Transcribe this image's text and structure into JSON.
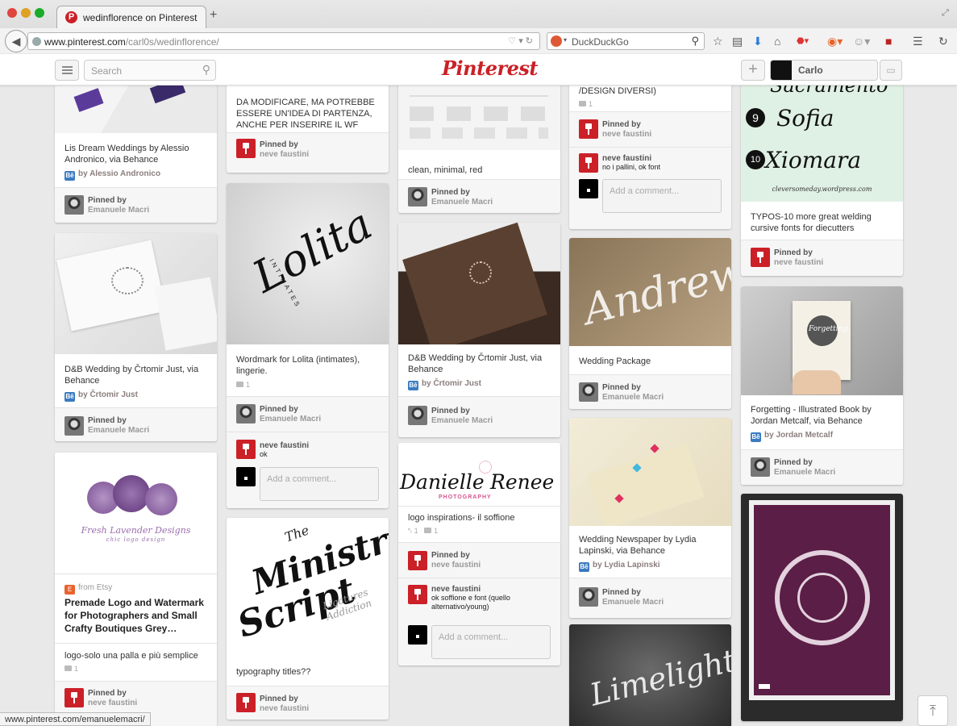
{
  "browser": {
    "tab_title": "wedinflorence on Pinterest",
    "url_host": "www.pinterest.com",
    "url_path": "/carl0s/wedinflorence/",
    "search_engine": "DuckDuckGo",
    "status_url": "www.pinterest.com/emanuelemacri/"
  },
  "header": {
    "search_placeholder": "Search",
    "logo": "Pinterest",
    "user_name": "Carlo"
  },
  "colors": {
    "pinterest_red": "#cb2027",
    "behance_blue": "#3b7bc0",
    "etsy_orange": "#e9622e"
  },
  "pins": {
    "p1": {
      "desc": "Lis Dream Weddings by Alessio Andronico, via Behance",
      "source": "by Alessio Andronico",
      "pinned_label": "Pinned by",
      "pinner": "Emanuele Macri"
    },
    "p2": {
      "desc": "D&B Wedding by Črtomir Just, via Behance",
      "source": "by Črtomir Just",
      "pinned_label": "Pinned by",
      "pinner": "Emanuele Macri"
    },
    "p3": {
      "source": "from Etsy",
      "title": "Premade Logo and Watermark for Photographers and Small Crafty Boutiques Grey…",
      "desc": "logo-solo una palla e più semplice",
      "comments": "1",
      "pinned_label": "Pinned by",
      "pinner": "neve faustini",
      "logo_script": "Fresh Lavender Designs",
      "logo_sub": "chic logo design"
    },
    "p4": {
      "desc": "DA MODIFICARE, MA POTREBBE ESSERE UN'IDEA DI PARTENZA, ANCHE PER INSERIRE IL WF",
      "pinned_label": "Pinned by",
      "pinner": "neve faustini"
    },
    "p5": {
      "desc": "Wordmark for Lolita (intimates), lingerie.",
      "comments": "1",
      "pinned_label": "Pinned by",
      "pinner": "Emanuele Macri",
      "commenter": "neve faustini",
      "comment": "ok",
      "add_comment": "Add a comment...",
      "art": "Lolita",
      "art_sub": "INTIMATES"
    },
    "p6": {
      "desc": "typography titles??",
      "pinned_label": "Pinned by",
      "pinner": "neve faustini",
      "art1": "The",
      "art2": "Ministry",
      "art3": "Script",
      "art4": "Ligatures Addiction"
    },
    "p7": {
      "desc": "clean, minimal, red",
      "pinned_label": "Pinned by",
      "pinner": "Emanuele Macri"
    },
    "p8": {
      "desc": "D&B Wedding by Črtomir Just, via Behance",
      "source": "by Črtomir Just",
      "pinned_label": "Pinned by",
      "pinner": "Emanuele Macri"
    },
    "p9": {
      "desc": "logo inspirations- il soffione",
      "likes": "1",
      "comments": "1",
      "pinned_label": "Pinned by",
      "pinner": "neve faustini",
      "commenter": "neve faustini",
      "comment": "ok soffione e font (quello alternativo/young)",
      "add_comment": "Add a comment...",
      "art1": "Danielle",
      "art2": "Renee",
      "art3": "PHOTOGRAPHY"
    },
    "p10": {
      "desc": "/DESIGN DIVERSI)",
      "comments": "1",
      "pinned_label": "Pinned by",
      "pinner": "neve faustini",
      "commenter": "neve faustini",
      "comment": "no i pallini, ok font",
      "add_comment": "Add a comment..."
    },
    "p11": {
      "desc": "Wedding Package",
      "pinned_label": "Pinned by",
      "pinner": "Emanuele Macri",
      "art": "Andrew"
    },
    "p12": {
      "desc": "Wedding Newspaper by Lydia Lapinski, via Behance",
      "source": "by Lydia Lapinski",
      "pinned_label": "Pinned by",
      "pinner": "Emanuele Macri"
    },
    "p13": {
      "art": "Limelight"
    },
    "p14": {
      "desc": "TYPOS-10 more great welding cursive fonts for diecutters",
      "pinned_label": "Pinned by",
      "pinner": "neve faustini",
      "art1": "Sacramento",
      "art2": "Sofia",
      "art3": "Xiomara",
      "num2": "9",
      "num3": "10",
      "art_url": "cleversomeday.wordpress.com"
    },
    "p15": {
      "desc": "Forgetting - Illustrated Book by Jordan Metcalf, via Behance",
      "source": "by Jordan Metcalf",
      "pinned_label": "Pinned by",
      "pinner": "Emanuele Macri",
      "art": "Forgetting"
    }
  }
}
